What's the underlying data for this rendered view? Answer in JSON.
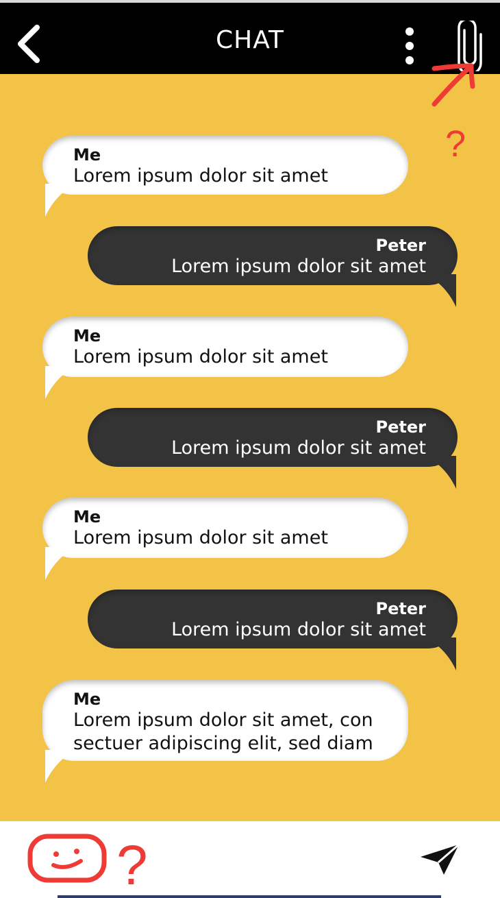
{
  "header": {
    "title": "CHAT",
    "back_icon": "chevron-left-icon",
    "menu_icon": "more-vertical-icon",
    "attach_icon": "paperclip-icon"
  },
  "messages": [
    {
      "sender": "Me",
      "text": "Lorem ipsum dolor sit amet"
    },
    {
      "sender": "Peter",
      "text": "Lorem ipsum dolor sit amet"
    },
    {
      "sender": "Me",
      "text": "Lorem ipsum dolor sit amet"
    },
    {
      "sender": "Peter",
      "text": "Lorem ipsum dolor sit amet"
    },
    {
      "sender": "Me",
      "text": "Lorem ipsum dolor sit amet"
    },
    {
      "sender": "Peter",
      "text": "Lorem ipsum dolor sit amet"
    },
    {
      "sender": "Me",
      "text_line1": "Lorem ipsum dolor sit amet, con",
      "text_line2": "sectuer adipiscing elit, sed diam"
    }
  ],
  "footer": {
    "emoji_icon": "smiley-face-icon",
    "send_icon": "send-paper-plane-icon"
  },
  "annotations": {
    "question_mark": "?",
    "color": "#ef3b35"
  },
  "colors": {
    "background": "#f2c346",
    "header": "#000000",
    "bubble_me": "#ffffff",
    "bubble_peter": "#333333",
    "annotation": "#ef3b35"
  }
}
